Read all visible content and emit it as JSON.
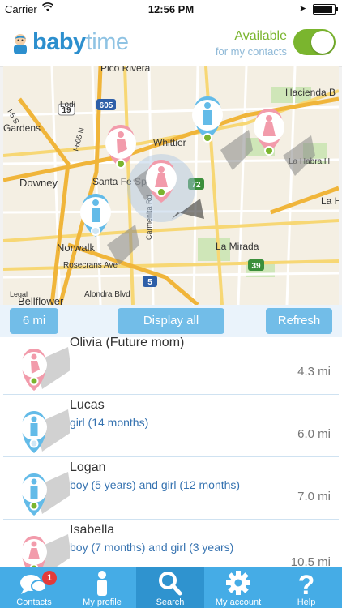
{
  "status_bar": {
    "carrier": "Carrier",
    "time": "12:56 PM"
  },
  "header": {
    "logo_bold": "baby",
    "logo_light": "time",
    "availability_title": "Available",
    "availability_sub": "for my contacts",
    "toggle_on": true
  },
  "map": {
    "labels": [
      "Pico Rivera",
      "Hacienda B",
      "Gardens",
      "Whittier",
      "Downey",
      "Santa Fe Sp",
      "La Habra H",
      "La H",
      "Norwalk",
      "Rosecrans Ave",
      "La Mirada",
      "Legal",
      "Alondra Blvd",
      "Bellflower",
      "Carmenita Rd",
      "I-5 S",
      "I-605 N",
      "Lodi"
    ],
    "shields": [
      "19",
      "605",
      "5",
      "72",
      "39",
      "5"
    ]
  },
  "map_controls": {
    "radius": "6 mi",
    "display_all": "Display all",
    "refresh": "Refresh"
  },
  "contacts": [
    {
      "name": "Olivia (Future mom)",
      "detail": "",
      "distance": "4.3 mi",
      "type": "pregnant"
    },
    {
      "name": "Lucas",
      "detail": "girl (14 months)",
      "distance": "6.0 mi",
      "type": "man"
    },
    {
      "name": "Logan",
      "detail": "boy (5 years) and girl (12 months)",
      "distance": "7.0 mi",
      "type": "man"
    },
    {
      "name": "Isabella",
      "detail": "boy (7 months) and girl (3 years)",
      "distance": "10.5 mi",
      "type": "woman"
    }
  ],
  "tabs": [
    {
      "label": "Contacts",
      "icon": "chat-icon",
      "badge": "1"
    },
    {
      "label": "My profile",
      "icon": "person-icon"
    },
    {
      "label": "Search",
      "icon": "search-icon"
    },
    {
      "label": "My account",
      "icon": "gear-icon"
    },
    {
      "label": "Help",
      "icon": "question-icon"
    }
  ],
  "colors": {
    "accent": "#45ace6",
    "green": "#7ab52e",
    "pink": "#f29bab",
    "blue_pin": "#63bbe8"
  }
}
